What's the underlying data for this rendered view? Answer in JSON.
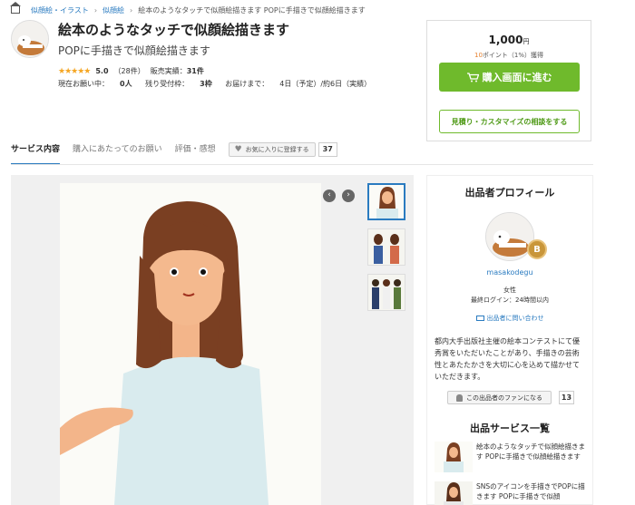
{
  "breadcrumb": {
    "items": [
      "似顔絵・イラスト",
      "似顔絵",
      "絵本のようなタッチで似顔絵描きます POPに手描きで似顔絵描きます"
    ]
  },
  "service": {
    "title": "絵本のようなタッチで似顔絵描きます",
    "subtitle": "POPに手描きで似顔絵描きます",
    "stars": "★★★★★",
    "rating": "5.0",
    "reviews": "（28件）",
    "sales_label": "販売実績：",
    "sales": "31件",
    "requests_label": "現在お願い中：",
    "requests": "0人",
    "slots_label": "残り受付枠：",
    "slots": "3枠",
    "delivery_label": "お届けまで：",
    "delivery": "4日（予定）/約6日（実績）"
  },
  "pricebox": {
    "price": "1,000",
    "yen": "円",
    "points_num": "10",
    "points_text": "ポイント（1%）獲得",
    "buy_label": "購入画面に進む",
    "consult_label": "見積り・カスタマイズの相談をする"
  },
  "tabs": [
    {
      "label": "サービス内容"
    },
    {
      "label": "購入にあたってのお願い"
    },
    {
      "label": "評価・感想"
    }
  ],
  "favorite": {
    "label": "お気に入りに登録する",
    "count": "37"
  },
  "profile": {
    "heading": "出品者プロフィール",
    "badge": "B",
    "name": "masakodegu",
    "gender": "女性",
    "last_login": "最終ログイン：24時間以内",
    "contact": "出品者に問い合わせ",
    "description": "都内大手出版社主催の絵本コンテストにて優秀賞をいただいたことがあり、手描きの芸術性とあたたかさを大切に心を込めて描かせていただきます。",
    "fan_label": "この出品者のファンになる",
    "fan_count": "13"
  },
  "services": {
    "heading": "出品サービス一覧",
    "items": [
      {
        "text": "絵本のようなタッチで似顔絵描きます POPに手描きで似顔絵描きます"
      },
      {
        "text": "SNSのアイコンを手描きでPOPに描きます POPに手描きで似顔"
      }
    ]
  },
  "icons": {
    "home": "home-icon",
    "cart": "cart-icon",
    "heart": "heart-icon",
    "mail": "mail-icon",
    "person": "person-icon",
    "prev": "chevron-left-icon",
    "next": "chevron-right-icon"
  },
  "colors": {
    "accent": "#2a7bc0",
    "buy": "#6fba2c",
    "star": "#f5a623",
    "badge": "#c9963a"
  }
}
